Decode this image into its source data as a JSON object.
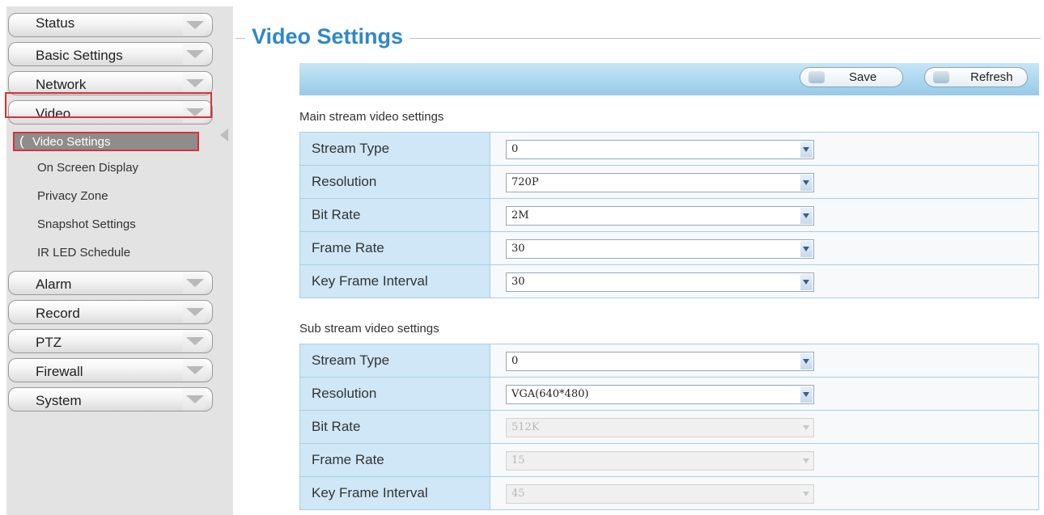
{
  "sidebar": {
    "menus": [
      {
        "label": "Status"
      },
      {
        "label": "Basic Settings"
      },
      {
        "label": "Network"
      },
      {
        "label": "Video"
      }
    ],
    "video_submenu": {
      "active": "Video Settings",
      "items": [
        "On Screen Display",
        "Privacy Zone",
        "Snapshot Settings",
        "IR LED Schedule"
      ]
    },
    "menus_after": [
      {
        "label": "Alarm"
      },
      {
        "label": "Record"
      },
      {
        "label": "PTZ"
      },
      {
        "label": "Firewall"
      },
      {
        "label": "System"
      }
    ]
  },
  "page": {
    "title": "Video Settings"
  },
  "toolbar": {
    "save_label": "Save",
    "refresh_label": "Refresh"
  },
  "main_stream": {
    "heading": "Main stream video settings",
    "rows": [
      {
        "label": "Stream Type",
        "value": "0",
        "enabled": true
      },
      {
        "label": "Resolution",
        "value": "720P",
        "enabled": true
      },
      {
        "label": "Bit Rate",
        "value": "2M",
        "enabled": true
      },
      {
        "label": "Frame Rate",
        "value": "30",
        "enabled": true
      },
      {
        "label": "Key Frame Interval",
        "value": "30",
        "enabled": true
      }
    ]
  },
  "sub_stream": {
    "heading": "Sub stream video settings",
    "rows": [
      {
        "label": "Stream Type",
        "value": "0",
        "enabled": true
      },
      {
        "label": "Resolution",
        "value": "VGA(640*480)",
        "enabled": true
      },
      {
        "label": "Bit Rate",
        "value": "512K",
        "enabled": false
      },
      {
        "label": "Frame Rate",
        "value": "15",
        "enabled": false
      },
      {
        "label": "Key Frame Interval",
        "value": "45",
        "enabled": false
      }
    ]
  },
  "colors": {
    "title": "#2f88c6",
    "highlight_border": "#d9323a",
    "toolbar": "#a9d5ee",
    "label_cell": "#cfe7f6"
  }
}
